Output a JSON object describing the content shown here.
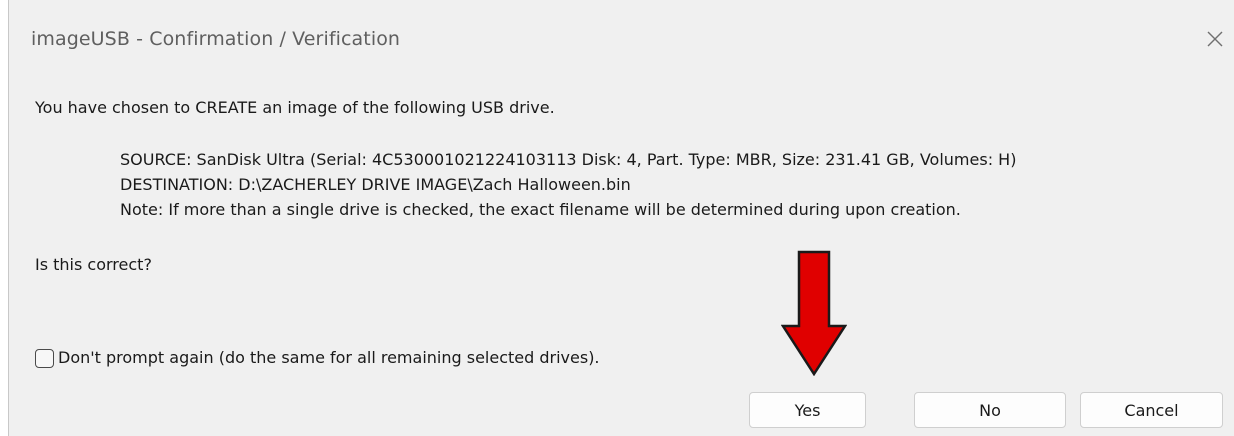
{
  "window": {
    "title": "imageUSB - Confirmation / Verification"
  },
  "message": {
    "intro": "You have chosen to CREATE an image of the following USB drive.",
    "source": "SOURCE: SanDisk Ultra (Serial: 4C530001021224103113 Disk: 4, Part. Type: MBR, Size: 231.41 GB, Volumes: H)",
    "destination": "DESTINATION: D:\\ZACHERLEY DRIVE IMAGE\\Zach Halloween.bin",
    "note": "Note: If more than a single drive is checked, the exact filename will be determined during upon creation.",
    "question": "Is this correct?"
  },
  "checkbox": {
    "label": "Don't prompt again (do the same for all remaining selected drives).",
    "checked": false
  },
  "buttons": {
    "yes": "Yes",
    "no": "No",
    "cancel": "Cancel"
  },
  "icons": {
    "close": "close-icon",
    "annotation": "arrow-down-icon"
  },
  "colors": {
    "dialog_background": "#f0f0f0",
    "title_text": "#5f5f5f",
    "button_background": "#fdfdfd",
    "annotation_arrow": "#e00000"
  }
}
